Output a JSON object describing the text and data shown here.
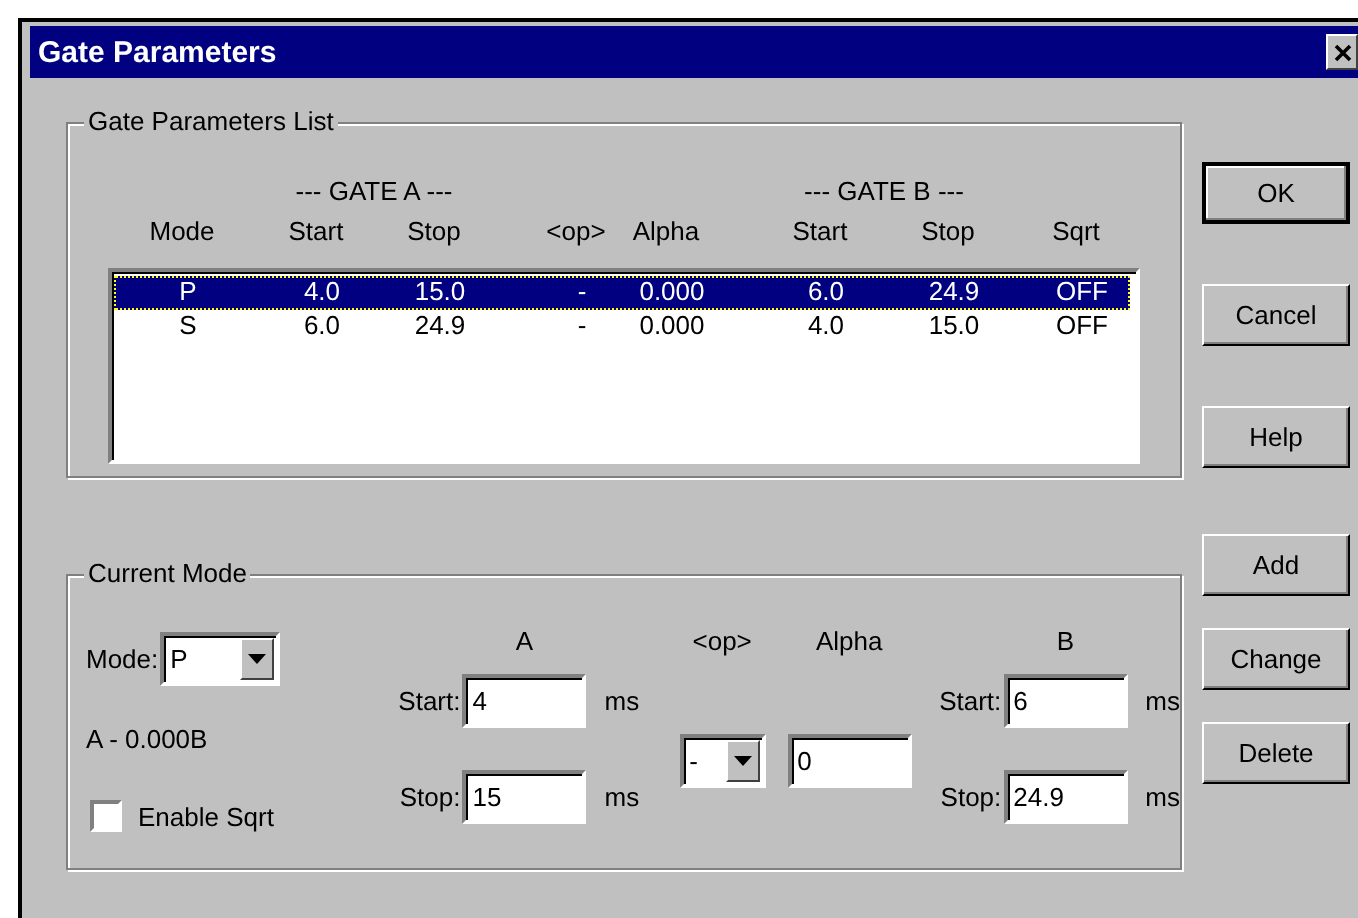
{
  "window": {
    "title": "Gate Parameters"
  },
  "list_group": {
    "title": "Gate Parameters List",
    "group_headers": [
      "--- GATE A ---",
      "--- GATE B ---"
    ],
    "columns": [
      "Mode",
      "Start",
      "Stop",
      "<op>",
      "Alpha",
      "Start",
      "Stop",
      "Sqrt"
    ],
    "rows": [
      {
        "selected": true,
        "cells": [
          "P",
          "4.0",
          "15.0",
          "-",
          "0.000",
          "6.0",
          "24.9",
          "OFF"
        ]
      },
      {
        "selected": false,
        "cells": [
          "S",
          "6.0",
          "24.9",
          "-",
          "0.000",
          "4.0",
          "15.0",
          "OFF"
        ]
      }
    ]
  },
  "dialog_buttons": [
    {
      "label": "OK"
    },
    {
      "label": "Cancel"
    },
    {
      "label": "Help"
    }
  ],
  "current_mode": {
    "title": "Current Mode",
    "mode_label": "Mode:",
    "mode_value": "P",
    "expression": "A - 0.000B",
    "enable_sqrt": {
      "label": "Enable Sqrt",
      "checked": false
    },
    "a": {
      "title": "A",
      "start_label": "Start:",
      "start": "4",
      "stop_label": "Stop:",
      "stop": "15",
      "start_unit": "ms",
      "stop_unit": "ms"
    },
    "op": {
      "title": "<op>",
      "value": "-"
    },
    "alpha": {
      "title": "Alpha",
      "value": "0"
    },
    "b": {
      "title": "B",
      "start_label": "Start:",
      "start": "6",
      "stop_label": "Stop:",
      "stop": "24.9",
      "start_unit": "ms",
      "stop_unit": "ms"
    }
  },
  "edit_buttons": [
    {
      "label": "Add"
    },
    {
      "label": "Change"
    },
    {
      "label": "Delete"
    }
  ]
}
